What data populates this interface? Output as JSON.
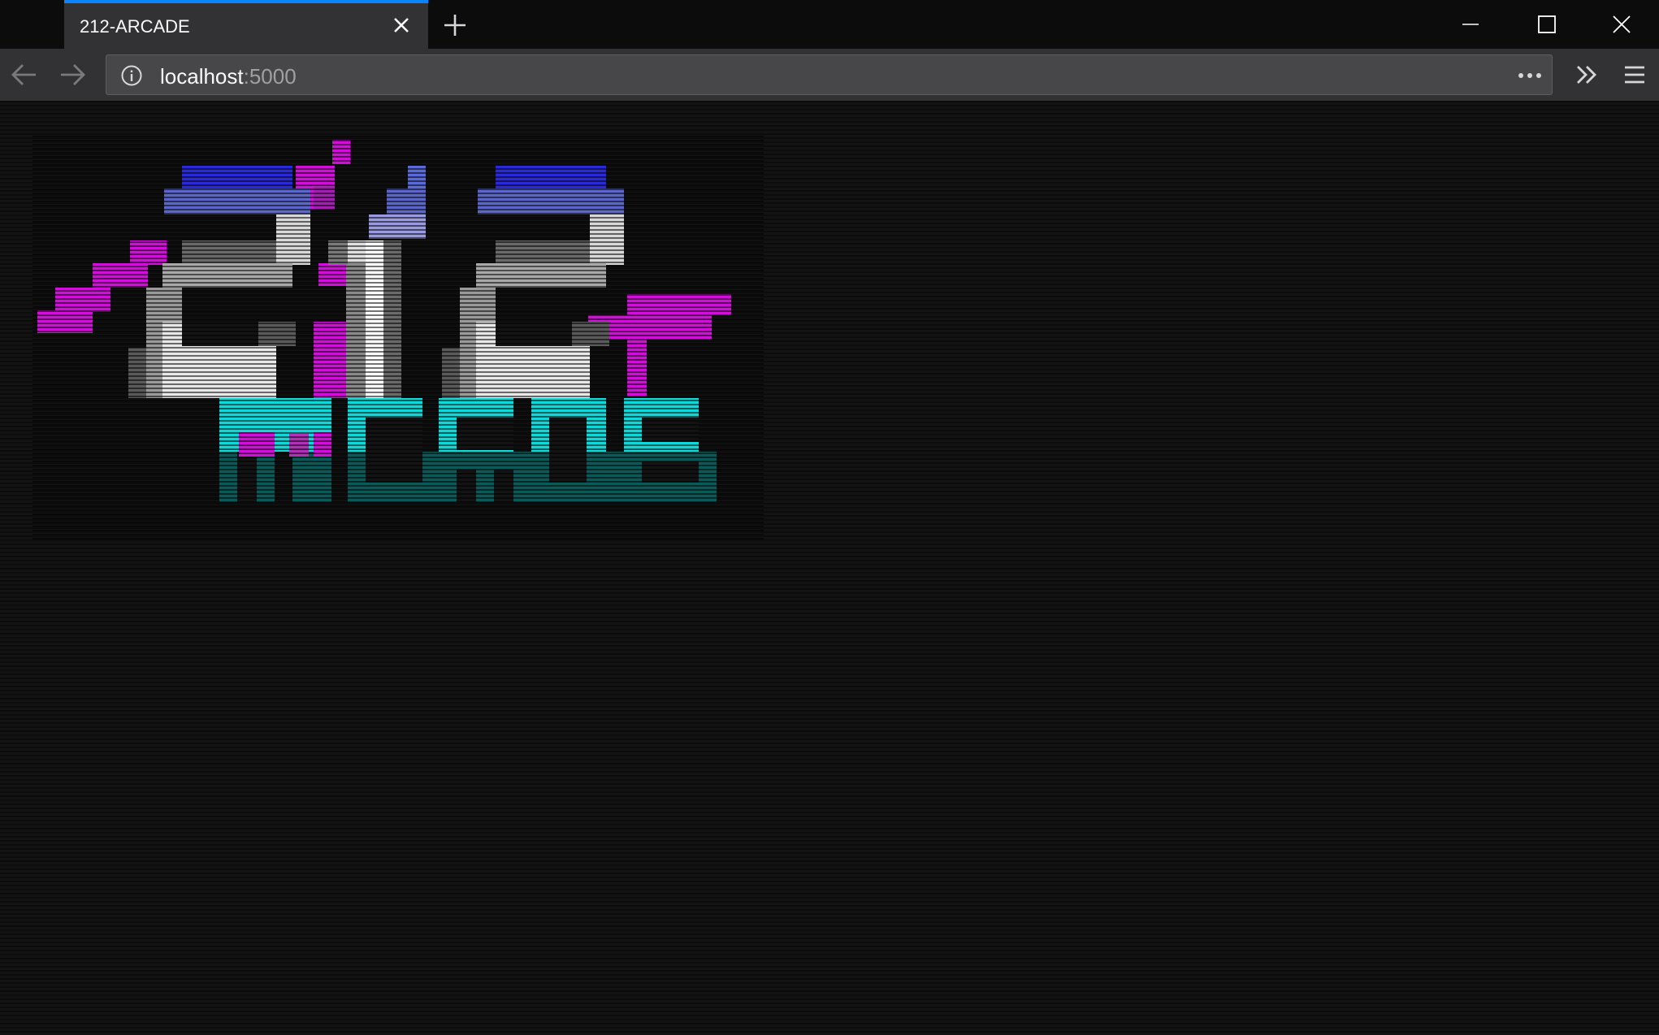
{
  "browser": {
    "tab": {
      "title": "212-ARCADE"
    },
    "address": {
      "host": "localhost",
      "port": ":5000"
    },
    "accent_color": "#0a84ff",
    "icons": {
      "tab_close": "close-icon",
      "new_tab": "plus-icon",
      "back": "arrow-left-icon",
      "forward": "arrow-right-icon",
      "site_info": "info-icon",
      "page_actions": "ellipsis-icon",
      "overflow": "double-chevron-icon",
      "menu": "hamburger-icon",
      "minimize": "minimize-icon",
      "maximize": "maximize-icon",
      "close_window": "close-window-icon"
    }
  },
  "page": {
    "logo": {
      "alt_text": "212 ARCADE",
      "colors": {
        "magenta": "#d010d8",
        "blue": "#2a2ad8",
        "lavender": "#9a9ae0",
        "white": "#f0f0f0",
        "gray": "#8a8a8a",
        "cyan": "#10d8d8",
        "teal": "#0c5a58"
      }
    }
  }
}
